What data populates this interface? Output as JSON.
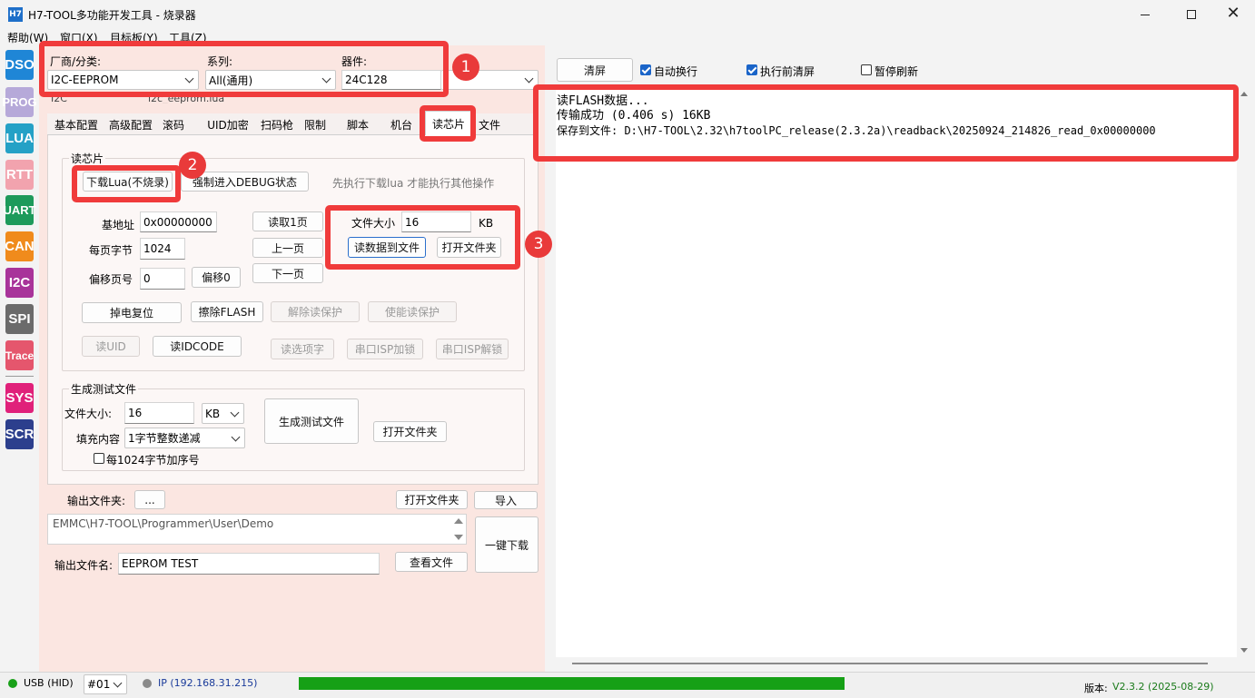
{
  "window": {
    "title": "H7-TOOL多功能开发工具 - 烧录器",
    "app_icon": "H7"
  },
  "menu": [
    "帮助(W)",
    "窗口(X)",
    "目标板(Y)",
    "工具(Z)"
  ],
  "sidebar": [
    "DSO",
    "PROG",
    "LUA",
    "RTT",
    "UART",
    "CAN",
    "I2C",
    "SPI",
    "Trace",
    "SYS",
    "SCR"
  ],
  "device": {
    "vendor_label": "厂商/分类:",
    "vendor_value": "I2C-EEPROM",
    "series_label": "系列:",
    "series_value": "All(通用)",
    "device_label": "器件:",
    "device_value": "24C128",
    "hidden_left": "I2C",
    "hidden_right": "i2c_eeprom.lua"
  },
  "tabs": [
    "基本配置",
    "高级配置",
    "滚码",
    "UID加密",
    "扫码枪",
    "限制",
    "脚本",
    "机台",
    "读芯片",
    "文件"
  ],
  "active_tab": "读芯片",
  "read_chip": {
    "group_title": "读芯片",
    "download_lua": "下载Lua(不烧录)",
    "force_debug": "强制进入DEBUG状态",
    "hint": "先执行下载lua 才能执行其他操作",
    "base_addr_label": "基地址",
    "base_addr": "0x00000000",
    "page_bytes_label": "每页字节",
    "page_bytes": "1024",
    "offset_page_label": "偏移页号",
    "offset_page": "0",
    "offset0": "偏移0",
    "read_page": "读取1页",
    "prev_page": "上一页",
    "next_page": "下一页",
    "file_size_label": "文件大小",
    "file_size": "16",
    "file_size_unit": "KB",
    "read_to_file": "读数据到文件",
    "open_folder": "打开文件夹",
    "power_reset": "掉电复位",
    "erase_flash": "擦除FLASH",
    "remove_protect": "解除读保护",
    "enable_protect": "使能读保护",
    "read_uid": "读UID",
    "read_idcode": "读IDCODE",
    "read_option": "读选项字",
    "serial_isp_lock": "串口ISP加锁",
    "serial_isp_unlock": "串口ISP解锁"
  },
  "gen_test": {
    "group_title": "生成测试文件",
    "size_label": "文件大小:",
    "size_value": "16",
    "size_unit": "KB",
    "fill_label": "填充内容",
    "fill_value": "1字节整数递减",
    "seq_label": "每1024字节加序号",
    "generate": "生成测试文件",
    "open_folder": "打开文件夹"
  },
  "output": {
    "folder_label": "输出文件夹:",
    "browse": "...",
    "open_folder": "打开文件夹",
    "import": "导入",
    "folder_path": "EMMC\\H7-TOOL\\Programmer\\User\\Demo",
    "one_click": "一键下载",
    "filename_label": "输出文件名:",
    "filename": "EEPROM TEST",
    "view_file": "查看文件"
  },
  "log_toolbar": {
    "clear": "清屏",
    "auto_wrap": "自动换行",
    "clear_before": "执行前清屏",
    "pause": "暂停刷新"
  },
  "log_lines": [
    "读FLASH数据...",
    "传输成功 (0.406 s) 16KB",
    "保存到文件: D:\\H7-TOOL\\2.32\\h7toolPC_release(2.3.2a)\\readback\\20250924_214826_read_0x00000000"
  ],
  "annotations": [
    "1",
    "2",
    "3"
  ],
  "status": {
    "usb": "USB (HID)",
    "port": "#01",
    "ip": "IP (192.168.31.215)",
    "progress": 0.5,
    "version_label": "版本:",
    "version": "V2.3.2 (2025-08-29)"
  },
  "colors": {
    "left_bg": "#fbe6e1",
    "accent": "#1a64c8",
    "annotation": "#f03b3b",
    "progress": "#16a016"
  }
}
